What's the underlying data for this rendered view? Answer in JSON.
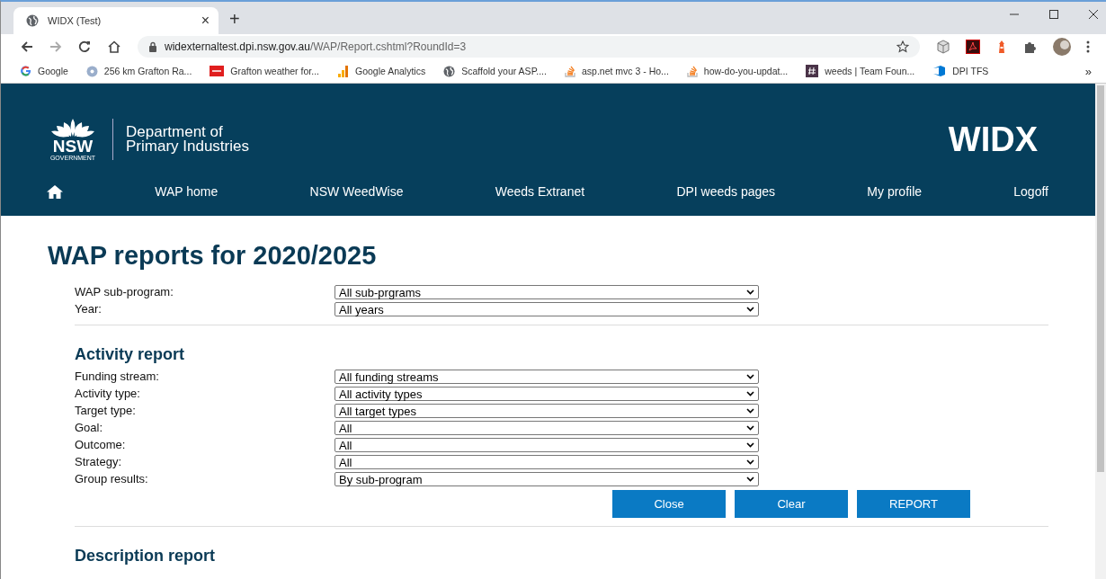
{
  "browser": {
    "tab_title": "WIDX (Test)",
    "tab_close": "×",
    "new_tab": "+",
    "url_host": "widexternaltest.dpi.nsw.gov.au",
    "url_path": "/WAP/Report.cshtml?RoundId=3",
    "bookmarks": [
      {
        "label": "Google",
        "kind": "google"
      },
      {
        "label": "256 km Grafton Ra...",
        "kind": "disc"
      },
      {
        "label": "Grafton weather for...",
        "kind": "weather"
      },
      {
        "label": "Google Analytics",
        "kind": "analytics"
      },
      {
        "label": "Scaffold your ASP....",
        "kind": "globe"
      },
      {
        "label": "asp.net mvc 3 - Ho...",
        "kind": "stack"
      },
      {
        "label": "how-do-you-updat...",
        "kind": "stack"
      },
      {
        "label": "weeds | Team Foun...",
        "kind": "hash"
      },
      {
        "label": "DPI TFS",
        "kind": "devops"
      }
    ],
    "more": "»"
  },
  "header": {
    "logo_mark": "NSW",
    "logo_sub": "GOVERNMENT",
    "department_line1": "Department of",
    "department_line2": "Primary Industries",
    "app_name": "WIDX",
    "nav": [
      "WAP home",
      "NSW WeedWise",
      "Weeds Extranet",
      "DPI weeds pages",
      "My profile",
      "Logoff"
    ]
  },
  "title": "WAP reports for 2020/2025",
  "filters": [
    {
      "label": "WAP sub-program:",
      "value": "All sub-prgrams"
    },
    {
      "label": "Year:",
      "value": "All years"
    }
  ],
  "activity_report": {
    "heading": "Activity report",
    "fields": [
      {
        "label": "Funding stream:",
        "value": "All funding streams"
      },
      {
        "label": "Activity type:",
        "value": "All activity types"
      },
      {
        "label": "Target type:",
        "value": "All target types"
      },
      {
        "label": "Goal:",
        "value": "All"
      },
      {
        "label": "Outcome:",
        "value": "All"
      },
      {
        "label": "Strategy:",
        "value": "All"
      },
      {
        "label": "Group results:",
        "value": "By sub-program"
      }
    ],
    "buttons": [
      "Close",
      "Clear",
      "REPORT"
    ]
  },
  "description_report": {
    "heading": "Description report"
  }
}
